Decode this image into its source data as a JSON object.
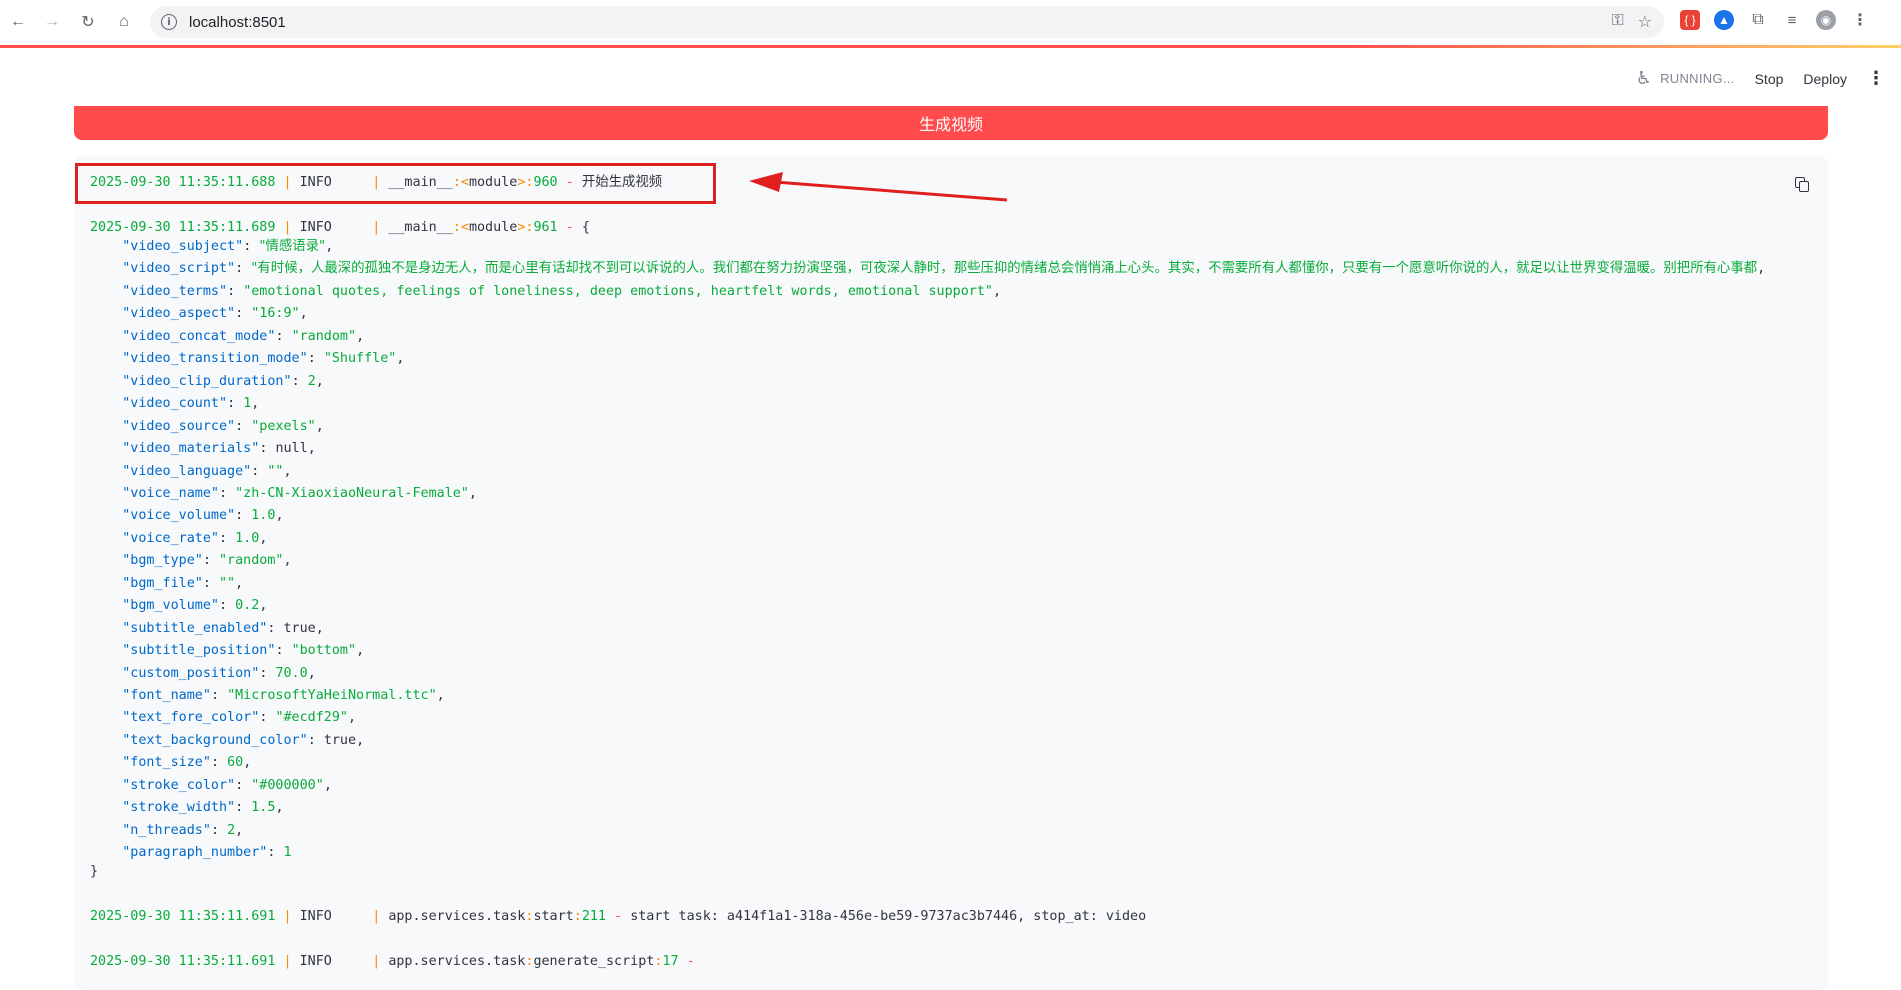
{
  "browser": {
    "url": "localhost:8501"
  },
  "header": {
    "status": "RUNNING...",
    "stop_label": "Stop",
    "deploy_label": "Deploy"
  },
  "main": {
    "generate_button": "生成视频"
  },
  "log": {
    "line1": {
      "timestamp": "2025-09-30 11:35:11.688",
      "level": "INFO    ",
      "source": "__main__",
      "module": "module",
      "lineno": "960",
      "message": "开始生成视频"
    },
    "line2": {
      "timestamp": "2025-09-30 11:35:11.689",
      "level": "INFO    ",
      "source": "__main__",
      "module": "module",
      "lineno": "961",
      "message": "{"
    },
    "params": [
      {
        "key": "\"video_subject\"",
        "value": "\"情感语录\"",
        "type": "str"
      },
      {
        "key": "\"video_script\"",
        "value": "\"有时候，人最深的孤独不是身边无人，而是心里有话却找不到可以诉说的人。我们都在努力扮演坚强，可夜深人静时，那些压抑的情绪总会悄悄涌上心头。其实，不需要所有人都懂你，只要有一个愿意听你说的人，就足以让世界变得温暖。别把所有心事都",
        "type": "str"
      },
      {
        "key": "\"video_terms\"",
        "value": "\"emotional quotes, feelings of loneliness, deep emotions, heartfelt words, emotional support\"",
        "type": "str"
      },
      {
        "key": "\"video_aspect\"",
        "value": "\"16:9\"",
        "type": "str"
      },
      {
        "key": "\"video_concat_mode\"",
        "value": "\"random\"",
        "type": "str"
      },
      {
        "key": "\"video_transition_mode\"",
        "value": "\"Shuffle\"",
        "type": "str"
      },
      {
        "key": "\"video_clip_duration\"",
        "value": "2",
        "type": "num"
      },
      {
        "key": "\"video_count\"",
        "value": "1",
        "type": "num"
      },
      {
        "key": "\"video_source\"",
        "value": "\"pexels\"",
        "type": "str"
      },
      {
        "key": "\"video_materials\"",
        "value": "null",
        "type": "kw"
      },
      {
        "key": "\"video_language\"",
        "value": "\"\"",
        "type": "str"
      },
      {
        "key": "\"voice_name\"",
        "value": "\"zh-CN-XiaoxiaoNeural-Female\"",
        "type": "str"
      },
      {
        "key": "\"voice_volume\"",
        "value": "1.0",
        "type": "num"
      },
      {
        "key": "\"voice_rate\"",
        "value": "1.0",
        "type": "num"
      },
      {
        "key": "\"bgm_type\"",
        "value": "\"random\"",
        "type": "str"
      },
      {
        "key": "\"bgm_file\"",
        "value": "\"\"",
        "type": "str"
      },
      {
        "key": "\"bgm_volume\"",
        "value": "0.2",
        "type": "num"
      },
      {
        "key": "\"subtitle_enabled\"",
        "value": "true",
        "type": "kw"
      },
      {
        "key": "\"subtitle_position\"",
        "value": "\"bottom\"",
        "type": "str"
      },
      {
        "key": "\"custom_position\"",
        "value": "70.0",
        "type": "num"
      },
      {
        "key": "\"font_name\"",
        "value": "\"MicrosoftYaHeiNormal.ttc\"",
        "type": "str"
      },
      {
        "key": "\"text_fore_color\"",
        "value": "\"#ecdf29\"",
        "type": "str"
      },
      {
        "key": "\"text_background_color\"",
        "value": "true",
        "type": "kw"
      },
      {
        "key": "\"font_size\"",
        "value": "60",
        "type": "num"
      },
      {
        "key": "\"stroke_color\"",
        "value": "\"#000000\"",
        "type": "str"
      },
      {
        "key": "\"stroke_width\"",
        "value": "1.5",
        "type": "num"
      },
      {
        "key": "\"n_threads\"",
        "value": "2",
        "type": "num"
      },
      {
        "key": "\"paragraph_number\"",
        "value": "1",
        "type": "num"
      }
    ],
    "close_brace": "}",
    "line3": {
      "timestamp": "2025-09-30 11:35:11.691",
      "level": "INFO    ",
      "source": "app.services.task",
      "func": "start",
      "lineno": "211",
      "message": "start task: a414f1a1-318a-456e-be59-9737ac3b7446, stop_at: video"
    },
    "line4": {
      "timestamp": "2025-09-30 11:35:11.691",
      "level": "INFO    ",
      "source": "app.services.task",
      "func": "generate_script",
      "lineno": "17"
    }
  },
  "colors": {
    "primary": "#ff4b4b",
    "timestamp": "#09ab3b",
    "key": "#0068c9",
    "annotation": "#e02020"
  }
}
